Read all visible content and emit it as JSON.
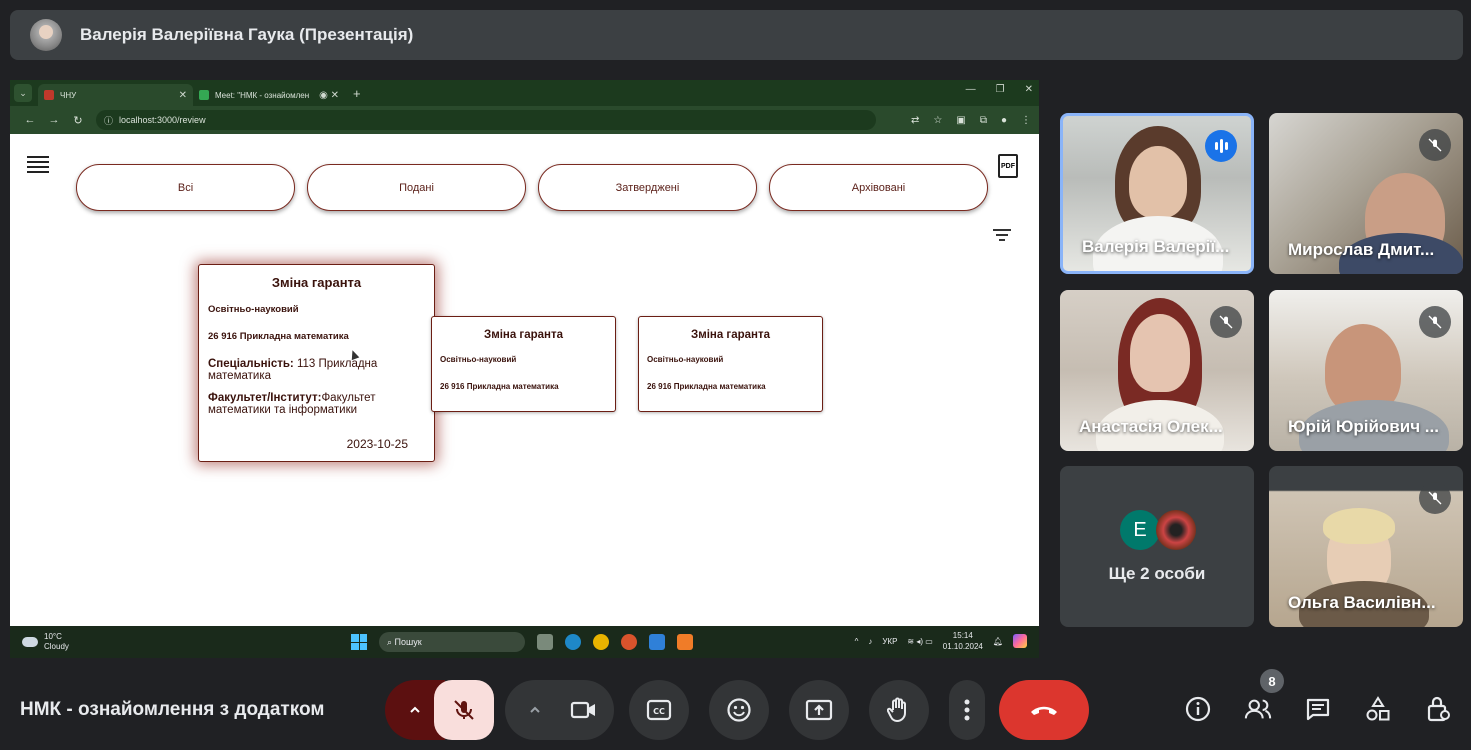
{
  "presenter": {
    "title": "Валерія Валеріївна Гаука (Презентація)"
  },
  "browser": {
    "tabs": [
      {
        "label": "ЧНУ",
        "active": true
      },
      {
        "label": "Meet: \"НМК - ознайомлен",
        "active": false
      }
    ],
    "url": "localhost:3000/review"
  },
  "app": {
    "pdf_label": "PDF",
    "filters": [
      "Всі",
      "Подані",
      "Затверджені",
      "Архівовані"
    ],
    "cards": [
      {
        "title": "Зміна гаранта",
        "level": "Освітньо-науковий",
        "program": "26 916 Прикладна математика",
        "specialty_label": "Спеціальність:",
        "specialty_value": " 113 Прикладна математика",
        "faculty_label": "Факультет/Інститут:",
        "faculty_value": "Факультет математики та інформатики",
        "date": "2023-10-25"
      },
      {
        "title": "Зміна гаранта",
        "level": "Освітньо-науковий",
        "program": "26 916 Прикладна математика"
      },
      {
        "title": "Зміна гаранта",
        "level": "Освітньо-науковий",
        "program": "26 916 Прикладна математика"
      }
    ]
  },
  "taskbar": {
    "temp": "10°C",
    "weather": "Cloudy",
    "search": "Пошук",
    "lang": "УКР",
    "time": "15:14",
    "date": "01.10.2024"
  },
  "participants": [
    {
      "name": "Валерія Валерії...",
      "speaking": true
    },
    {
      "name": "Мирослав Дмит...",
      "muted": true
    },
    {
      "name": "Анастасія Олек...",
      "muted": true
    },
    {
      "name": "Юрій Юрійович ...",
      "muted": true
    },
    {
      "name": "Ще 2 особи",
      "avatar_letter": "E"
    },
    {
      "name": "Ольга Василівн...",
      "muted": true
    }
  ],
  "meeting": {
    "name": "НМК - ознайомлення з додатком",
    "participant_count": "8"
  },
  "colors": {
    "end_call": "#dc362e",
    "mic_off_bg": "#f9dedc",
    "speaking": "#1a73e8",
    "card_border": "#6b1e14"
  }
}
